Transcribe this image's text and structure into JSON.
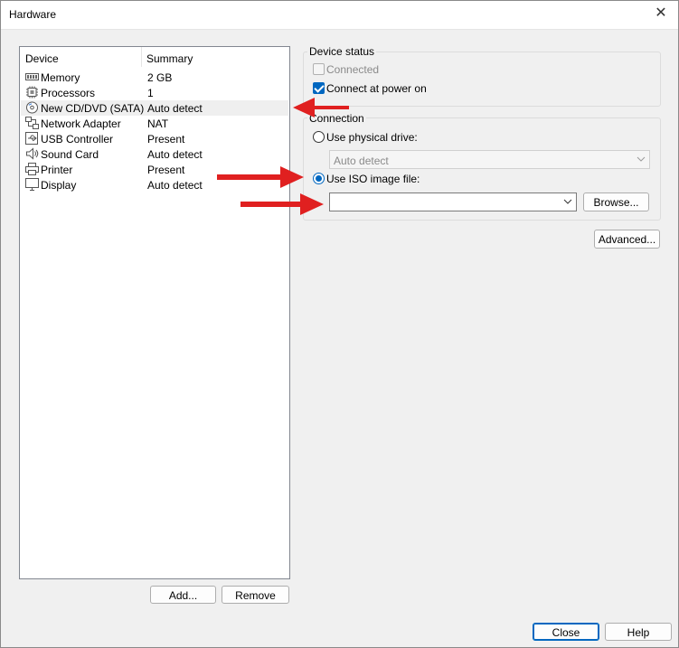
{
  "window": {
    "title": "Hardware"
  },
  "device_list": {
    "columns": {
      "device": "Device",
      "summary": "Summary"
    },
    "rows": [
      {
        "name": "Memory",
        "summary": "2 GB",
        "icon": "memory-icon"
      },
      {
        "name": "Processors",
        "summary": "1",
        "icon": "processor-icon"
      },
      {
        "name": "New CD/DVD (SATA)",
        "summary": "Auto detect",
        "icon": "cd-dvd-icon",
        "selected": true
      },
      {
        "name": "Network Adapter",
        "summary": "NAT",
        "icon": "network-adapter-icon"
      },
      {
        "name": "USB Controller",
        "summary": "Present",
        "icon": "usb-icon"
      },
      {
        "name": "Sound Card",
        "summary": "Auto detect",
        "icon": "speaker-icon"
      },
      {
        "name": "Printer",
        "summary": "Present",
        "icon": "printer-icon"
      },
      {
        "name": "Display",
        "summary": "Auto detect",
        "icon": "display-icon"
      }
    ],
    "add_label": "Add...",
    "remove_label": "Remove"
  },
  "device_status": {
    "title": "Device status",
    "connected_label": "Connected",
    "connected_checked": false,
    "connected_enabled": false,
    "connect_power_label": "Connect at power on",
    "connect_power_checked": true
  },
  "connection": {
    "title": "Connection",
    "physical_label": "Use physical drive:",
    "physical_selected": false,
    "physical_value": "Auto detect",
    "iso_label": "Use ISO image file:",
    "iso_selected": true,
    "iso_value": "",
    "browse_label": "Browse..."
  },
  "advanced_label": "Advanced...",
  "footer": {
    "close_label": "Close",
    "help_label": "Help"
  },
  "colors": {
    "accent": "#0067c0",
    "annotation_arrow": "#e02020"
  }
}
